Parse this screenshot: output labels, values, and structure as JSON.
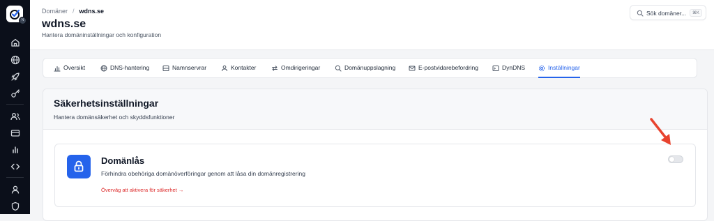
{
  "sidebar": {
    "logo": "check-circle-logo",
    "badge": "N",
    "items": [
      {
        "name": "home-icon"
      },
      {
        "name": "globe-icon"
      },
      {
        "name": "rocket-icon"
      },
      {
        "name": "key-icon"
      },
      {
        "name": "users-icon"
      },
      {
        "name": "credit-card-icon"
      },
      {
        "name": "bar-chart-icon"
      },
      {
        "name": "code-icon"
      },
      {
        "name": "user-icon"
      },
      {
        "name": "shield-icon"
      }
    ]
  },
  "header": {
    "breadcrumb": [
      "Domäner",
      "wdns.se"
    ],
    "title": "wdns.se",
    "subtitle": "Hantera domäninställningar och konfiguration",
    "search_placeholder": "Sök domäner...",
    "search_shortcut": "⌘K"
  },
  "tabs": [
    {
      "label": "Översikt",
      "icon": "chart-icon"
    },
    {
      "label": "DNS-hantering",
      "icon": "globe-icon"
    },
    {
      "label": "Namnservrar",
      "icon": "server-icon"
    },
    {
      "label": "Kontakter",
      "icon": "user-icon"
    },
    {
      "label": "Omdirigeringar",
      "icon": "redirect-icon"
    },
    {
      "label": "Domänuppslagning",
      "icon": "search-icon"
    },
    {
      "label": "E-postvidarebefordring",
      "icon": "mail-icon"
    },
    {
      "label": "DynDNS",
      "icon": "terminal-icon"
    },
    {
      "label": "Inställningar",
      "icon": "gear-icon",
      "active": true
    }
  ],
  "panel": {
    "title": "Säkerhetsinställningar",
    "subtitle": "Hantera domänsäkerhet och skyddsfunktioner"
  },
  "card": {
    "title": "Domänlås",
    "description": "Förhindra obehöriga domänöverföringar genom att låsa din domänregistrering",
    "warning": "Överväg att aktivera för säkerhet →",
    "toggle_on": false
  },
  "colors": {
    "accent": "#2563eb",
    "warning": "#dc2626",
    "sidebar": "#0b0f1a",
    "arrow": "#e8432e"
  }
}
